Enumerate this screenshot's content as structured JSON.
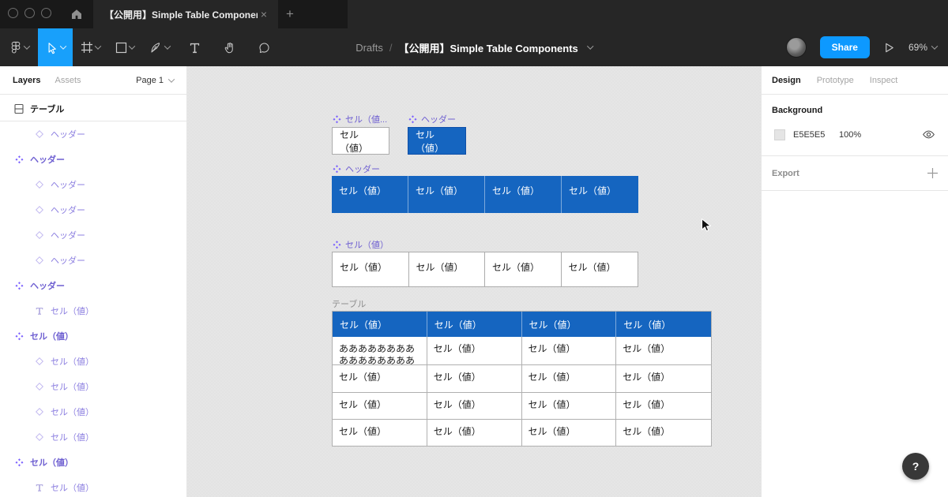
{
  "titlebar": {
    "tab_title": "【公開用】Simple Table Components",
    "close_label": "×",
    "new_tab_label": "+"
  },
  "toolbar": {
    "breadcrumb_parent": "Drafts",
    "breadcrumb_separator": "/",
    "breadcrumb_title": "【公開用】Simple Table Components",
    "share_label": "Share",
    "zoom_level": "69%",
    "tools": [
      "main-menu",
      "move-tool",
      "frame-tool",
      "shape-tool",
      "pen-tool",
      "text-tool",
      "hand-tool",
      "comment-tool"
    ],
    "selected_tool": "move-tool"
  },
  "left_panel": {
    "tab_layers": "Layers",
    "tab_assets": "Assets",
    "page_selector": "Page 1",
    "layers": [
      {
        "type": "frame",
        "label": "テーブル",
        "indent": 0,
        "divider_after": true
      },
      {
        "type": "instance",
        "label": "ヘッダー",
        "indent": 1
      },
      {
        "type": "component",
        "label": "ヘッダー",
        "indent": 0
      },
      {
        "type": "instance",
        "label": "ヘッダー",
        "indent": 1
      },
      {
        "type": "instance",
        "label": "ヘッダー",
        "indent": 1
      },
      {
        "type": "instance",
        "label": "ヘッダー",
        "indent": 1
      },
      {
        "type": "instance",
        "label": "ヘッダー",
        "indent": 1
      },
      {
        "type": "component",
        "label": "ヘッダー",
        "indent": 0
      },
      {
        "type": "text",
        "label": "セル（値）",
        "indent": 1
      },
      {
        "type": "component",
        "label": "セル（値）",
        "indent": 0
      },
      {
        "type": "instance",
        "label": "セル（値）",
        "indent": 1
      },
      {
        "type": "instance",
        "label": "セル（値）",
        "indent": 1
      },
      {
        "type": "instance",
        "label": "セル（値）",
        "indent": 1
      },
      {
        "type": "instance",
        "label": "セル（値）",
        "indent": 1
      },
      {
        "type": "component",
        "label": "セル（値）",
        "indent": 0
      },
      {
        "type": "text",
        "label": "セル（値）",
        "indent": 1
      }
    ]
  },
  "canvas": {
    "components": [
      {
        "label": "セル（値...",
        "cells": [
          {
            "text": "セル（値）",
            "header": false
          }
        ]
      },
      {
        "label": "ヘッダー",
        "cells": [
          {
            "text": "セル（値）",
            "header": true
          }
        ]
      },
      {
        "label": "ヘッダー",
        "cells": [
          {
            "text": "セル（値）",
            "header": true
          },
          {
            "text": "セル（値）",
            "header": true
          },
          {
            "text": "セル（値）",
            "header": true
          },
          {
            "text": "セル（値）",
            "header": true
          }
        ]
      },
      {
        "label": "セル（値）",
        "cells": [
          {
            "text": "セル（値）",
            "header": false
          },
          {
            "text": "セル（値）",
            "header": false
          },
          {
            "text": "セル（値）",
            "header": false
          },
          {
            "text": "セル（値）",
            "header": false
          }
        ]
      }
    ],
    "table": {
      "label": "テーブル",
      "header": [
        "セル（値）",
        "セル（値）",
        "セル（値）",
        "セル（値）"
      ],
      "rows": [
        [
          "ああああああああああああああああああ",
          "セル（値）",
          "セル（値）",
          "セル（値）"
        ],
        [
          "セル（値）",
          "セル（値）",
          "セル（値）",
          "セル（値）"
        ],
        [
          "セル（値）",
          "セル（値）",
          "セル（値）",
          "セル（値）"
        ],
        [
          "セル（値）",
          "セル（値）",
          "セル（値）",
          "セル（値）"
        ]
      ]
    }
  },
  "right_panel": {
    "tab_design": "Design",
    "tab_prototype": "Prototype",
    "tab_inspect": "Inspect",
    "background_title": "Background",
    "background_hex": "E5E5E5",
    "background_opacity": "100%",
    "export_title": "Export",
    "help_label": "?"
  },
  "colors": {
    "accent_blue": "#18A0FB",
    "share_blue": "#0D99FF",
    "table_header_blue": "#1565C0",
    "component_purple": "#7B61FF",
    "canvas_bg": "#E5E5E5"
  }
}
